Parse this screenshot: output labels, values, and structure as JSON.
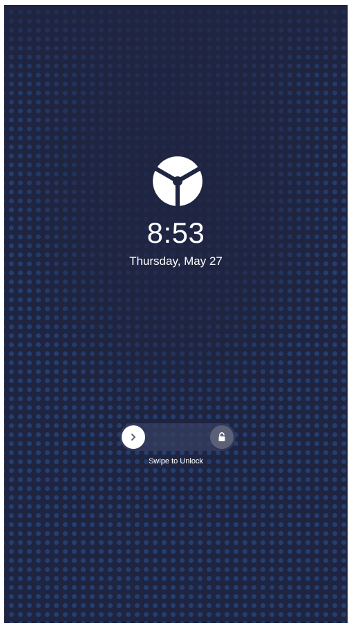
{
  "lock_screen": {
    "time": "8:53",
    "date": "Thursday, May 27",
    "logo_icon": "tri-segment-circle-logo-icon",
    "unlock_slider": {
      "label": "Swipe to Unlock",
      "knob_icon": "chevron-right-icon",
      "target_icon": "unlocked-padlock-icon"
    }
  },
  "colors": {
    "background": "#1f2440",
    "dot_pattern": "#28549a",
    "text": "#ffffff",
    "slider_track": "#363e60",
    "slider_knob": "#ffffff",
    "lock_circle": "#5b6077"
  }
}
